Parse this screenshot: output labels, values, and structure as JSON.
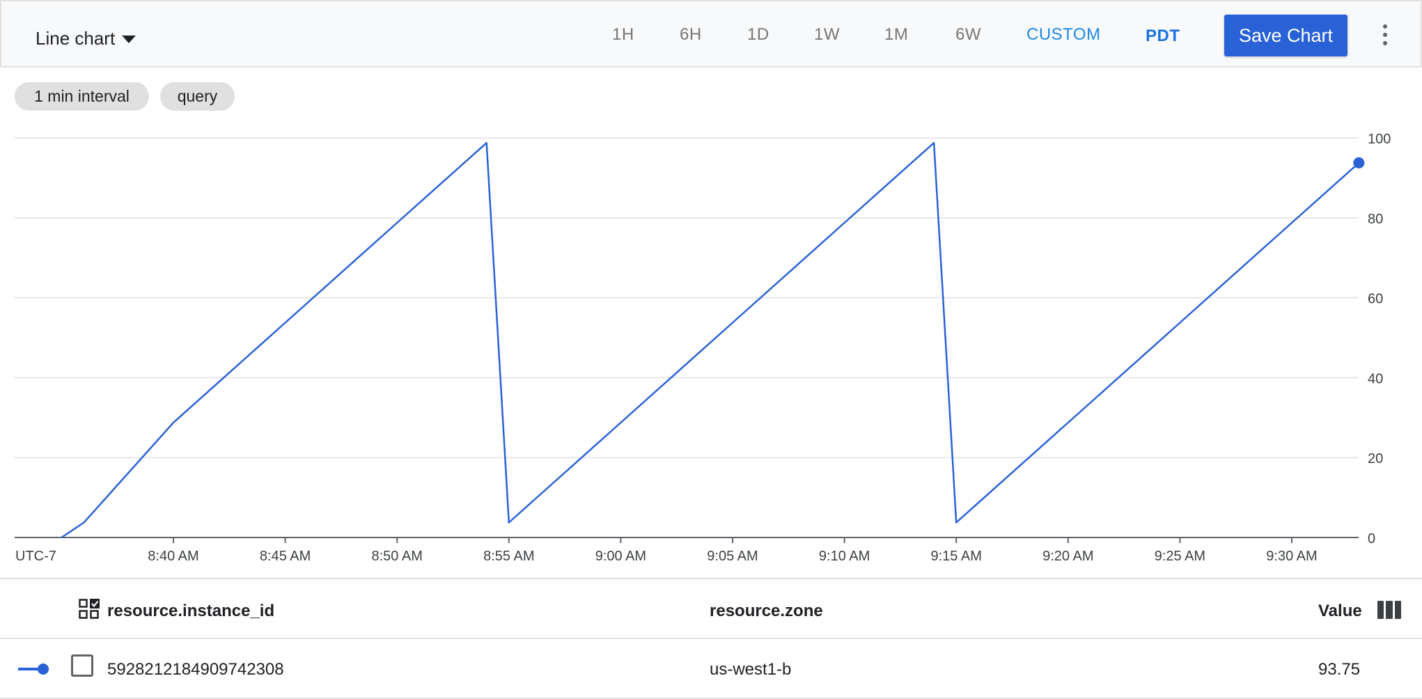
{
  "toolbar": {
    "chart_type_label": "Line chart",
    "range_buttons": [
      "1H",
      "6H",
      "1D",
      "1W",
      "1M",
      "6W"
    ],
    "custom_label": "CUSTOM",
    "timezone_label": "PDT",
    "save_label": "Save Chart",
    "more_icon": "more-vert-icon"
  },
  "chips": [
    "1 min interval",
    "query"
  ],
  "colors": {
    "series": "#2962d6",
    "custom": "#1e88e5",
    "toolbar_bg": "#f8f9fa",
    "chip_bg": "#e0e0e0",
    "grid": "#e0e0e0"
  },
  "chart_data": {
    "type": "line",
    "timezone_label": "UTC-7",
    "x_tick_labels": [
      "8:40 AM",
      "8:45 AM",
      "8:50 AM",
      "8:55 AM",
      "9:00 AM",
      "9:05 AM",
      "9:10 AM",
      "9:15 AM",
      "9:20 AM",
      "9:25 AM",
      "9:30 AM"
    ],
    "y_ticks": [
      0,
      20,
      40,
      60,
      80,
      100
    ],
    "ylim": [
      0,
      100
    ],
    "y_axis_position": "right",
    "grid": true,
    "series": [
      {
        "x": [
          "8:35 AM",
          "8:36 AM",
          "8:40 AM",
          "8:45 AM",
          "8:50 AM",
          "8:54 AM",
          "8:55 AM",
          "9:00 AM",
          "9:05 AM",
          "9:10 AM",
          "9:14 AM",
          "9:15 AM",
          "9:20 AM",
          "9:25 AM",
          "9:30 AM",
          "9:33 AM"
        ],
        "values": [
          0,
          3.75,
          28.75,
          53.75,
          78.75,
          98.75,
          3.75,
          28.75,
          53.75,
          78.75,
          98.75,
          3.75,
          28.75,
          53.75,
          78.75,
          93.75
        ]
      }
    ]
  },
  "table": {
    "select_icon": "select-all-icon",
    "columns_icon": "column-picker-icon",
    "headers": {
      "instance_id": "resource.instance_id",
      "zone": "resource.zone",
      "value": "Value"
    },
    "rows": [
      {
        "instance_id": "5928212184909742308",
        "zone": "us-west1-b",
        "value": "93.75"
      }
    ]
  }
}
